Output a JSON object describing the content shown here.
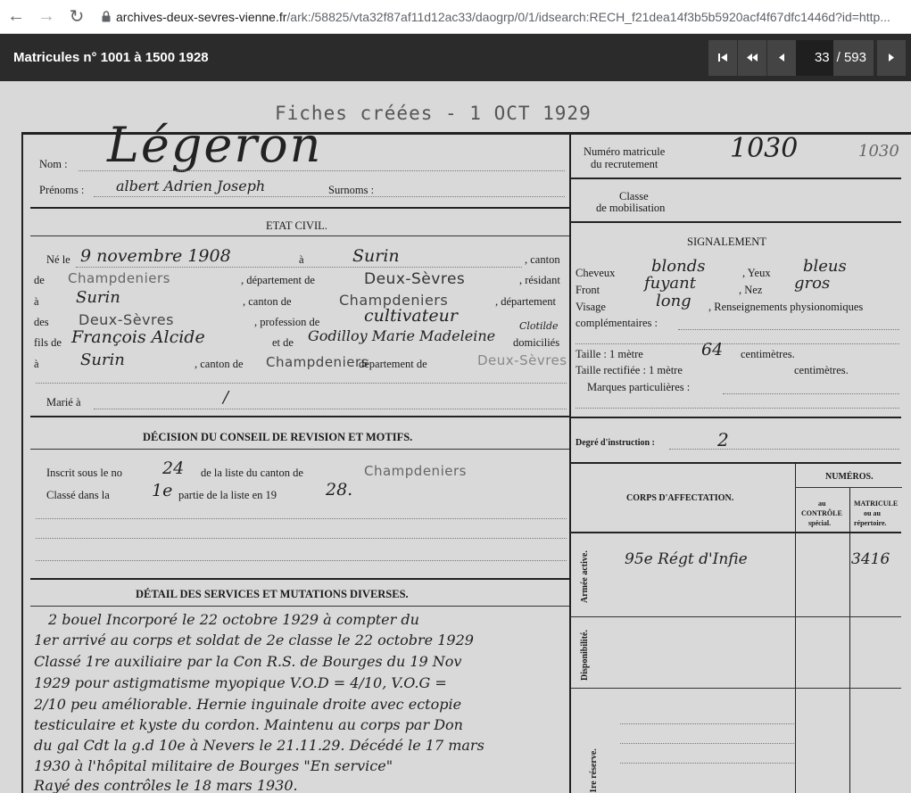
{
  "browser": {
    "host": "archives-deux-sevres-vienne.fr",
    "path": "/ark:/58825/vta32f87af11d12ac33/daogrp/0/1/idsearch:RECH_f21dea14f3b5b5920acf4f67dfc1446d?id=http..."
  },
  "viewer": {
    "title": "Matricules n° 1001 à 1500 1928",
    "current_page": "33",
    "total_pages": "/ 593"
  },
  "document": {
    "stamp": "Fiches   créées - 1 OCT 1929",
    "nom_label": "Nom :",
    "nom_value": "Légeron",
    "prenoms_label": "Prénoms :",
    "prenoms_value": "albert Adrien Joseph",
    "surnoms_label": "Surnoms :",
    "matricule_label_1": "Numéro matricule",
    "matricule_label_2": "du recrutement",
    "matricule_value": "1030",
    "matricule_value_2": "1030",
    "classe_label_1": "Classe",
    "classe_label_2": "de mobilisation",
    "etat_civil_title": "ETAT CIVIL.",
    "ne_le": "Né le",
    "ne_date": "9 novembre 1908",
    "a1": "à",
    "ne_lieu": "Surin",
    "canton1": ", canton",
    "de1": "de",
    "canton_value": "Champdeniers",
    "departement1": ", département de",
    "dept_value": "Deux-Sèvres",
    "resident": ", résidant",
    "a2": "à",
    "residant_lieu": "Surin",
    "canton2": ", canton de",
    "canton_value2": "Champdeniers",
    "departement2": ", département",
    "des": "des",
    "dept_value2": "Deux-Sèvres",
    "profession": ", profession de",
    "profession_value": "cultivateur",
    "fils_de": "fils de",
    "pere": "François Alcide",
    "et_de": "et de",
    "mere": "Godilloy Marie Madeleine",
    "mere_extra": "Clotilde",
    "domicilies": "domiciliés",
    "a3": "à",
    "domicile_lieu": "Surin",
    "canton3": ", canton de",
    "canton_value3": "Champdeniers",
    "departement3": "département de",
    "dept_value3": "Deux-Sèvres",
    "marie_label": "Marié à",
    "marie_value": "/",
    "decision_title": "DÉCISION DU CONSEIL DE REVISION ET MOTIFS.",
    "inscrit_label": "Inscrit sous le no",
    "inscrit_value": "24",
    "liste_canton": "de la liste du canton de",
    "liste_canton_value": "Champdeniers",
    "classe_label": "Classé dans la",
    "classe_value": "1e",
    "partie_label": "partie de la liste en 19",
    "partie_value": "28.",
    "detail_title": "DÉTAIL DES SERVICES ET MUTATIONS DIVERSES.",
    "detail_lines": [
      "2 bouel   Incorporé le 22 octobre 1929 à compter du",
      "1er arrivé au corps et soldat de 2e classe le 22 octobre 1929",
      "Classé 1re auxiliaire par la Con R.S. de Bourges du 19 Nov",
      "1929 pour astigmatisme myopique V.O.D = 4/10, V.O.G =",
      "2/10 peu améliorable. Hernie inguinale droite avec ectopie",
      "testiculaire et kyste du cordon. Maintenu au corps par Don",
      "du gal Cdt la g.d 10e à Nevers le 21.11.29.  Décédé le 17 mars",
      "1930 à l'hôpital militaire de Bourges \"En service\"",
      "Rayé des contrôles le 18 mars 1930."
    ],
    "signalement_title": "SIGNALEMENT",
    "cheveux_label": "Cheveux",
    "cheveux_value": "blonds",
    "yeux_label": ", Yeux",
    "yeux_value": "bleus",
    "front_label": "Front",
    "front_value": "fuyant",
    "nez_label": ", Nez",
    "nez_value": "gros",
    "visage_label": "Visage",
    "visage_value": "long",
    "renseignements": ", Renseignements physionomiques",
    "complementaires": "complémentaires :",
    "taille_label": "Taille : 1 mètre",
    "taille_value": "64",
    "centimetres": "centimètres.",
    "taille_rect": "Taille rectifiée : 1 mètre",
    "centimetres2": "centimètres.",
    "marques": "Marques particulières :",
    "degre_label": "Degré d'instruction :",
    "degre_value": "2",
    "corps_title": "CORPS D'AFFECTATION.",
    "numeros_title": "NUMÉROS.",
    "au_controle_1": "au",
    "au_controle_2": "CONTRÔLE",
    "au_controle_3": "spécial.",
    "matricule_col_1": "MATRICULE",
    "matricule_col_2": "ou au",
    "matricule_col_3": "répertoire.",
    "armee_active": "Armée active.",
    "affectation_value": "95e Régt d'Infie",
    "repertoire_value": "3416",
    "disponibilite": "Disponibilité.",
    "reserve": "1re réserve."
  }
}
